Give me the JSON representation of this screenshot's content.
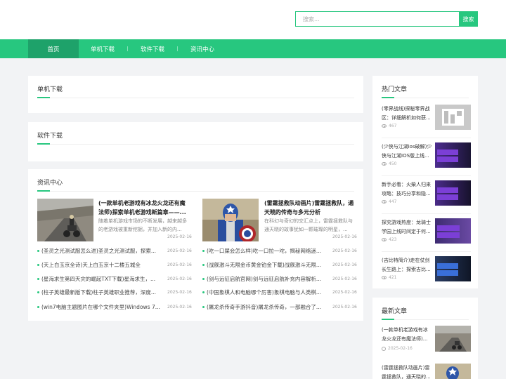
{
  "search": {
    "placeholder": "搜索...",
    "button": "搜索"
  },
  "nav": {
    "items": [
      "首页",
      "单机下载",
      "软件下载",
      "资讯中心"
    ]
  },
  "sections": {
    "standalone": "单机下载",
    "software": "软件下载",
    "news": "资讯中心"
  },
  "featured": [
    {
      "title": "(一款单机老游戏有冰龙火龙还有魔法师)探索单机老游戏新篇章——...",
      "desc": "随着单机游戏市场的不断发展，越来越多的老游戏被重新挖掘，并加入新的内...",
      "date": "2025-02-16"
    },
    {
      "title": "(雷霆拯救队动画片)雷霆拯救队，通天晓的传奇与多元分析",
      "desc": "在科幻与奇幻的交汇点上，雷霆拯救队与通天晓的故事犹如一颗璀璨的明星，...",
      "date": "2025-02-16"
    }
  ],
  "news_left": [
    {
      "text": "(圣灵之光测试服怎么进)圣灵之光测试服，探索...",
      "date": "2025-02-16"
    },
    {
      "text": "(天上白玉京全诗)天上白玉京十二楼五城全",
      "date": "2025-02-16"
    },
    {
      "text": "(星海求生第四天灾的崛起TXT下载)星海求生，...",
      "date": "2025-02-16"
    },
    {
      "text": "(柱子英雄最新版下载)柱子英雄职业推荐，深度...",
      "date": "2025-02-16"
    },
    {
      "text": "(win7电脑主题图片在哪个文件夹里)Windows 7...",
      "date": "2025-02-16"
    }
  ],
  "news_right": [
    {
      "text": "(吃一口屎会怎么样)吃一口拉一坨，揭秘网络迷...",
      "date": "2025-02-16"
    },
    {
      "text": "(战舰激斗无限金币黄金铂金下载)战舰激斗无限...",
      "date": "2025-02-16"
    },
    {
      "text": "(剑与远征启航官网)剑与远征启航补充内容解析...",
      "date": "2025-02-16"
    },
    {
      "text": "(中国象棋人和电脑哪个厉害)象棋电脑与人类棋...",
      "date": "2025-02-16"
    },
    {
      "text": "(屠龙杀传奇手游抖音)屠龙杀传奇，一部融合了...",
      "date": "2025-02-16"
    }
  ],
  "hot": {
    "title": "热门文章",
    "items": [
      {
        "text": "(零界战线)探秘零界战区：详细解析如何获...",
        "views": "467",
        "thumb_text": ""
      },
      {
        "text": "(少侠与江湖ios破解)少侠与江湖IOS版上线...",
        "views": "450",
        "thumb_text": "新手必看：火柴人归来攻略"
      },
      {
        "text": "新手必看：火柴人归来攻略：技巧分享和隐...",
        "views": "447",
        "thumb_text": "新手必看：火柴人归来攻略"
      },
      {
        "text": "探究游戏热度：龙骑士学园上线时间定于何...",
        "views": "423",
        "thumb_text": "探究游戏热度：龙骑士学园"
      },
      {
        "text": "(吉比特简介)走在仗剑长生路上：探索吉比...",
        "views": "421",
        "thumb_text": "迈进奥秘，进梦剑仔——吉"
      }
    ]
  },
  "latest": {
    "title": "最新文章",
    "items": [
      {
        "text": "(一款单机老游戏有冰龙火龙还有魔法师)...",
        "date": "2025-02-16"
      },
      {
        "text": "(雷霆拯救队动画片)雷霆拯救队，通天晓的...",
        "date": ""
      }
    ]
  },
  "colors": {
    "accent": "#27c77f",
    "accent_dark": "#1ea26a"
  }
}
